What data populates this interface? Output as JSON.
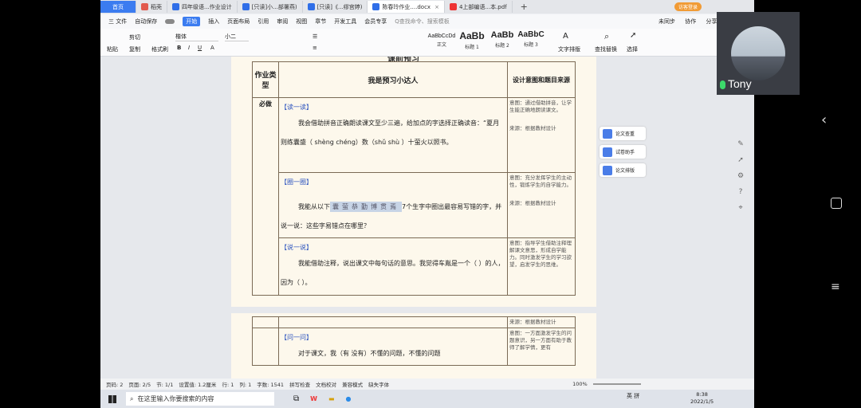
{
  "tabs": [
    {
      "label": "首页",
      "kind": "home"
    },
    {
      "label": "稻壳",
      "icon": "daoke-icon"
    },
    {
      "label": "四年级语...作业设计",
      "icon": "doc-icon"
    },
    {
      "label": "[只读]小...部署燕)",
      "icon": "doc-icon"
    },
    {
      "label": "[只读]《...缪宫婷)",
      "icon": "doc-icon"
    },
    {
      "label": "陈春玲作业....docx",
      "icon": "doc-icon",
      "active": true
    },
    {
      "label": "4上部编语...本.pdf",
      "icon": "pdf-icon"
    }
  ],
  "login_badge": "访客登录",
  "menu": {
    "file": "三 文件",
    "autosave": "自动保存",
    "items": [
      "开始",
      "插入",
      "页面布局",
      "引用",
      "审阅",
      "视图",
      "章节",
      "开发工具",
      "会员专享"
    ],
    "search_placeholder": "Q查找命令、搜索模板",
    "right": [
      "未同步",
      "协作",
      "分享"
    ]
  },
  "ribbon": {
    "paste": "粘贴",
    "cut": "剪切",
    "copy": "复制",
    "format_painter": "格式刷",
    "font": "楷体",
    "size": "小二",
    "styles": [
      {
        "preview": "AaBbCcDd",
        "label": "正文"
      },
      {
        "preview": "AaBb",
        "label": "标题 1"
      },
      {
        "preview": "AaBb",
        "label": "标题 2"
      },
      {
        "preview": "AaBbC",
        "label": "标题 3"
      }
    ],
    "text_tools": "文字排版",
    "find_replace": "查找替换",
    "select": "选择"
  },
  "doc": {
    "header_cut": "课前预习",
    "col1_header": "作业类型",
    "col2_header": "我是预习小达人",
    "col3_header": "设计意图和题目来源",
    "row_type": "必做",
    "sections": [
      {
        "title": "【读一读】",
        "text": "我会借助拼音正确朗读课文至少三遍，给加点的字选择正确读音：“夏月则练囊盛（ shèng    chéng）数（shǔ    shù ）十萤火以照书。",
        "intent": "意图：通过借助拼音，让学生能正确地朗读课文。",
        "source": "来源：根据教材设计"
      },
      {
        "title": "【圈一圈】",
        "text_before": "我能从以下",
        "chars": "囊萤恭勤博贯焉",
        "text_after": "7个生字中圈出最容易写错的字，并说一说：这些字易错点在哪里？",
        "intent": "意图：充分发挥学生的主动性，锻炼学生的自学能力。",
        "source": "来源：根据教材设计"
      },
      {
        "title": "【说一说】",
        "text": "我能借助注释，说出课文中每句话的意思。我觉得车胤是一个（     ）的人，因为（                         ）。",
        "intent": "意图：指导学生借助注释理解课文意思，形成自学能力。同时激发学生的学习欲望，启发学生的思维。",
        "source": ""
      }
    ],
    "page2": {
      "source_top": "来源：根据教材设计",
      "title": "【问一问】",
      "text": "对于课文，我（有      没有）不懂的问题，不懂的问题",
      "intent": "意图：一方面激发学生的问题意识，另一方面有助于教师了解学情，更有"
    }
  },
  "side_panel": [
    "论文查重",
    "试卷助手",
    "论文排版"
  ],
  "status": {
    "items": [
      "页码: 2",
      "页面: 2/5",
      "节: 1/1",
      "设置值: 1.2厘米",
      "行: 1",
      "列: 1",
      "字数: 1541",
      "拼写检查",
      "文档校对",
      "兼容模式",
      "缺失字体"
    ],
    "zoom": "100%"
  },
  "taskbar": {
    "search": "在这里输入你要搜索的内容",
    "ime": "英",
    "ime2": "拼",
    "time": "8:38",
    "date": "2022/1/5"
  },
  "video": {
    "name": "Tony"
  }
}
